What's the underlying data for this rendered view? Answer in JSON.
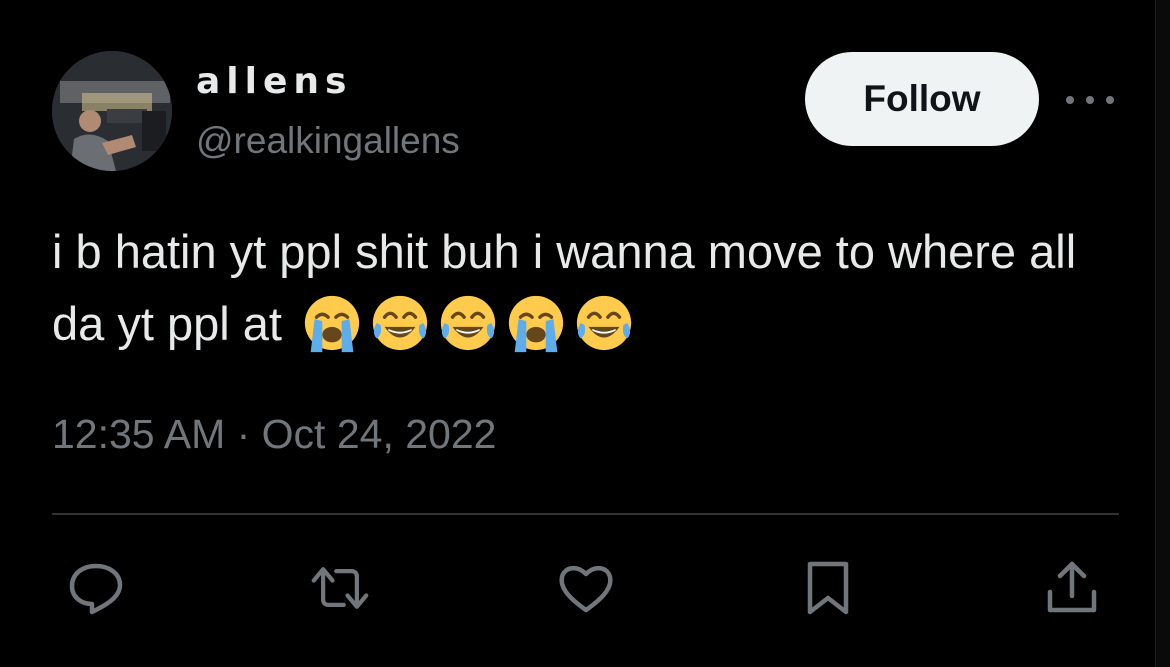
{
  "author": {
    "display_name": "allens",
    "handle": "@realkingallens",
    "avatar": "avatar-photo"
  },
  "follow_button": {
    "label": "Follow"
  },
  "more_menu": {
    "icon": "more-horizontal-icon"
  },
  "tweet": {
    "text": "i b hatin yt ppl shit buh i wanna move to where all da yt ppl at",
    "emojis": [
      "loudly-crying-face",
      "face-with-tears-of-joy",
      "face-with-tears-of-joy",
      "loudly-crying-face",
      "face-with-tears-of-joy"
    ],
    "timestamp": "12:35 AM · Oct 24, 2022"
  },
  "actions": [
    {
      "name": "reply",
      "icon": "reply-icon"
    },
    {
      "name": "retweet",
      "icon": "retweet-icon"
    },
    {
      "name": "like",
      "icon": "heart-icon"
    },
    {
      "name": "bookmark",
      "icon": "bookmark-icon"
    },
    {
      "name": "share",
      "icon": "share-icon"
    }
  ],
  "colors": {
    "background": "#000000",
    "primary_text": "#e7e9ea",
    "secondary_text": "#71767b",
    "button_bg": "#eff3f4",
    "divider": "#2f3336",
    "emoji_yellow": "#ffcb4c",
    "emoji_tears": "#5dadec"
  }
}
